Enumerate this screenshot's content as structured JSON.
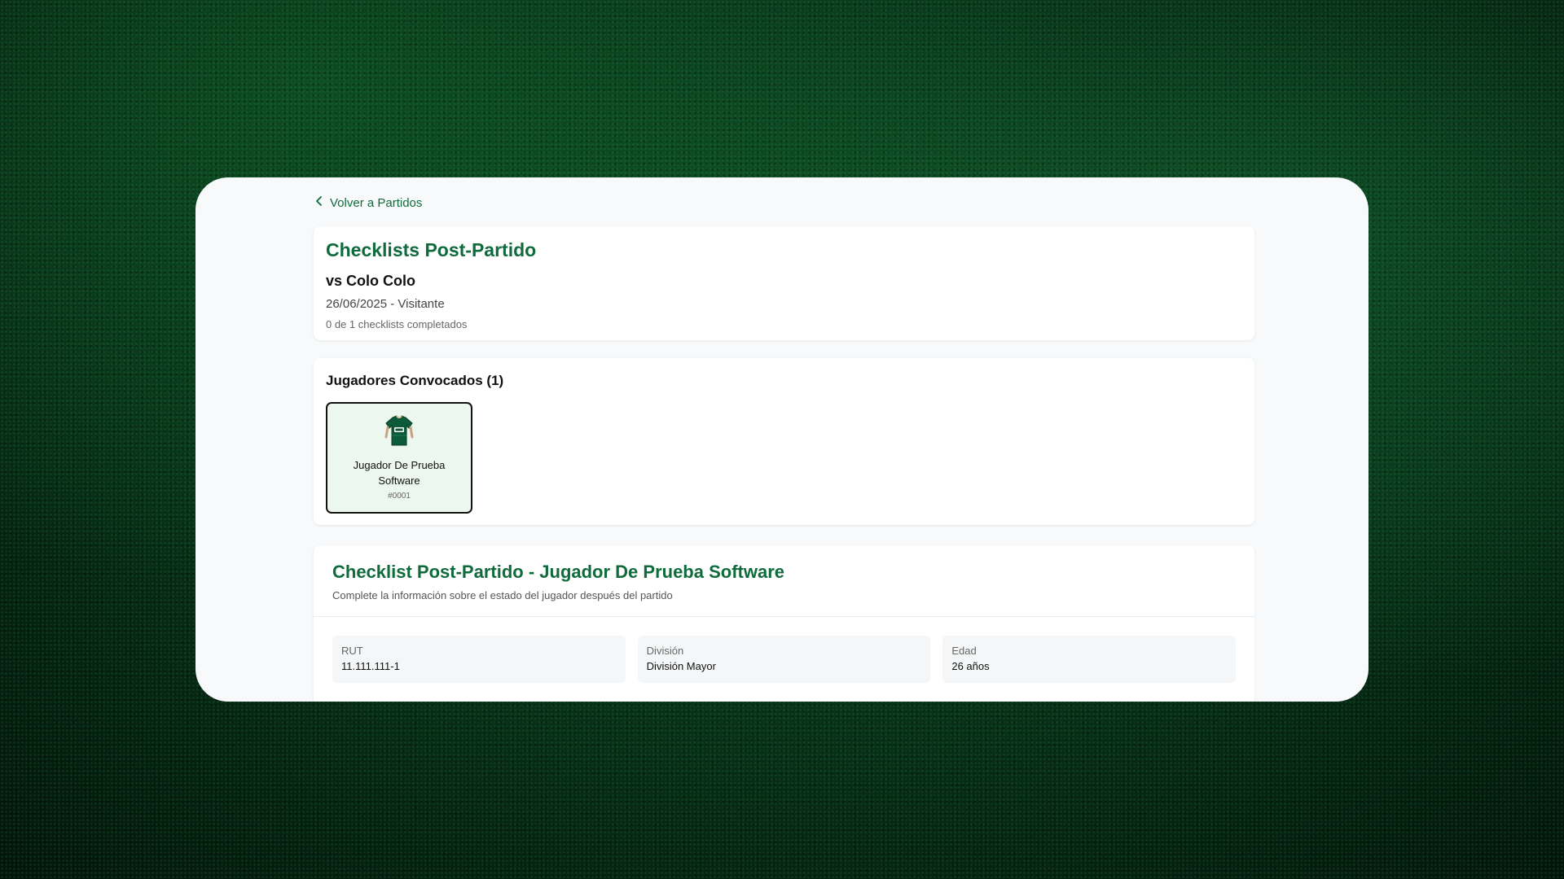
{
  "nav": {
    "back_label": "Volver a Partidos"
  },
  "header": {
    "title": "Checklists Post-Partido",
    "opponent": "vs Colo Colo",
    "date_location": "26/06/2025 - Visitante",
    "progress": "0 de 1 checklists completados"
  },
  "players": {
    "title": "Jugadores Convocados (1)",
    "items": [
      {
        "name": "Jugador De Prueba Software",
        "number": "#0001"
      }
    ]
  },
  "checklist": {
    "title": "Checklist Post-Partido - Jugador De Prueba Software",
    "subtitle": "Complete la información sobre el estado del jugador después del partido",
    "fields": [
      {
        "label": "RUT",
        "value": "11.111.111-1"
      },
      {
        "label": "División",
        "value": "División Mayor"
      },
      {
        "label": "Edad",
        "value": "26 años"
      }
    ]
  },
  "colors": {
    "brand_green": "#0f6b3c",
    "selected_card_bg": "#ecf7ef"
  },
  "icons": {
    "back": "chevron-left-icon",
    "player": "jersey-icon"
  }
}
